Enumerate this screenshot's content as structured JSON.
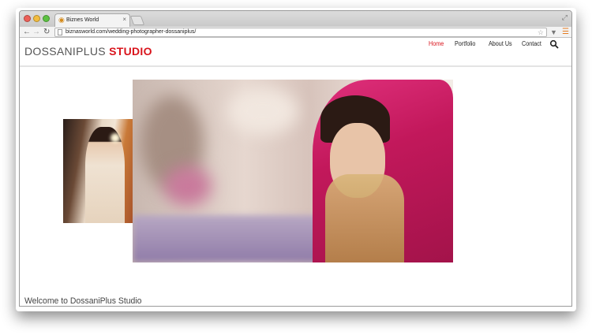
{
  "browser": {
    "tab_title": "Biznes World",
    "tab_close": "×",
    "url": "biznasworld.com/wedding-photographer-dossaniplus/",
    "nav_icons": {
      "back": "back-arrow-icon",
      "forward": "forward-arrow-icon",
      "reload": "reload-icon"
    }
  },
  "site": {
    "logo_part1": "DOSSANIPLUS ",
    "logo_part2": "STUDIO",
    "nav": {
      "home": "Home",
      "portfolio": "Portfolio",
      "about": "About Us",
      "contact": "Contact"
    },
    "welcome": "Welcome to DossaniPlus Studio"
  },
  "colors": {
    "accent": "#d9141c",
    "menu_icon": "#e57b20"
  }
}
